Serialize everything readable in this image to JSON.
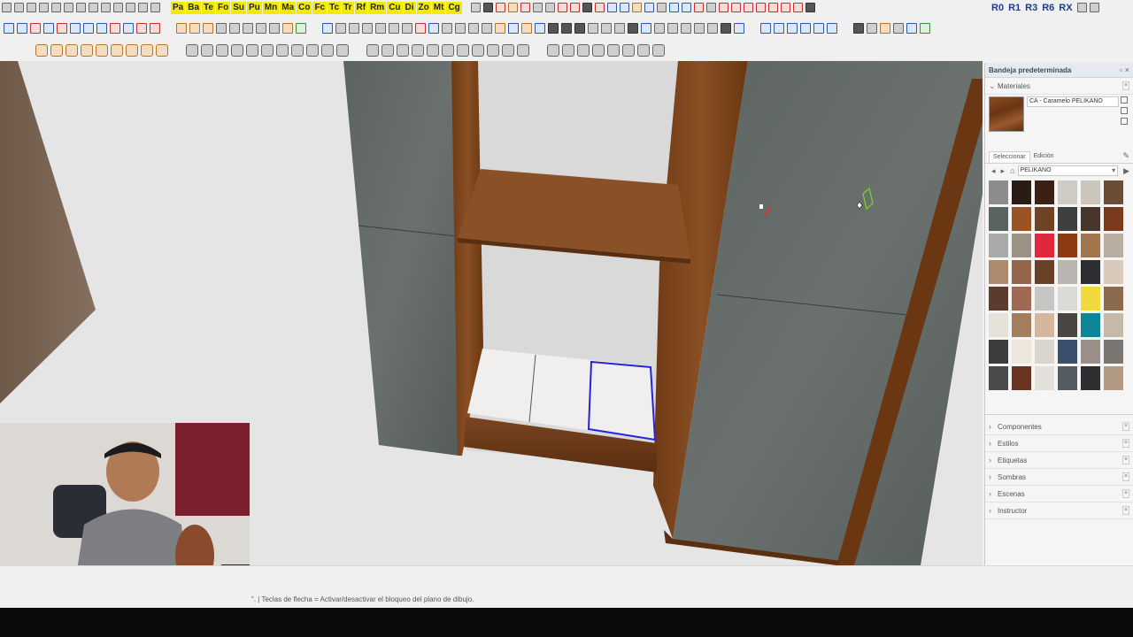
{
  "toolbar_row1": {
    "plugin_buttons": [
      "Pa",
      "Ba",
      "Te",
      "Fo",
      "Su",
      "Pu",
      "Mn",
      "Ma",
      "Co",
      "Fc",
      "Tc",
      "Tr",
      "Rf",
      "Rm",
      "Cu",
      "Di",
      "Zo",
      "Mt",
      "Cg"
    ],
    "right_buttons": [
      "R0",
      "R1",
      "R3",
      "R6",
      "RX"
    ]
  },
  "tray": {
    "title": "Bandeja predeterminada",
    "materials_panel": {
      "label": "Materiales",
      "current_material": "CA - Caramelo PELIKANO",
      "tabs": [
        "Seleccionar",
        "Edición"
      ],
      "library": "PELIKANO",
      "swatches": [
        "#8c8c8c",
        "#2a1b14",
        "#3a2113",
        "#cfcbc5",
        "#cbc5bc",
        "#6b4d35",
        "#5b6360",
        "#9a5322",
        "#6e4323",
        "#3d3f3f",
        "#47362c",
        "#7a3a1c",
        "#a8aaaa",
        "#9c9185",
        "#e0283d",
        "#8c3b12",
        "#a0764f",
        "#b9aca0",
        "#ad8a6e",
        "#93664a",
        "#6a4026",
        "#b9b5b0",
        "#2c2e31",
        "#d8c9bb",
        "#5b3b2e",
        "#9e6a52",
        "#c7c6c4",
        "#dcdad6",
        "#f1d93b",
        "#8b6a4d",
        "#e6e2da",
        "#a47e5c",
        "#d4b69a",
        "#4a4543",
        "#0d8795",
        "#c6b9a8",
        "#3c3c3c",
        "#ede7dc",
        "#d9d4cc",
        "#3b4f6d",
        "#9a8f88",
        "#7c7672",
        "#4a4a4a",
        "#6a3520",
        "#e3e0dc",
        "#555b63",
        "#2e2e2e",
        "#b29a82"
      ]
    },
    "collapsed_panels": [
      "Componentes",
      "Estilos",
      "Etiquetas",
      "Sombras",
      "Escenas",
      "Instructor"
    ]
  },
  "status": {
    "text": "\". | Teclas de flecha = Activar/desactivar el bloqueo del plano de dibujo."
  }
}
